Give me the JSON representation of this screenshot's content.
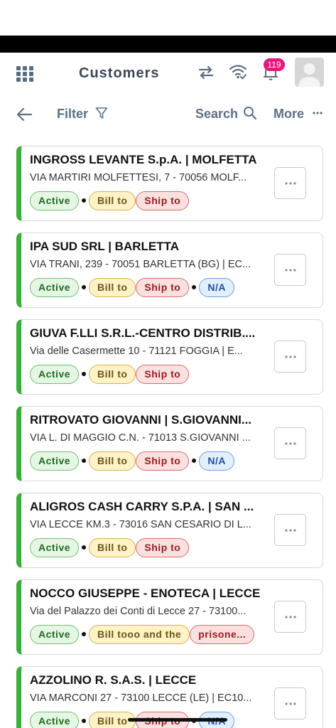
{
  "header": {
    "title": "Customers",
    "notification_count": "119"
  },
  "toolbar": {
    "filter_label": "Filter",
    "search_label": "Search",
    "more_label": "More"
  },
  "colors": {
    "accent_green": "#3aae3a",
    "badge_pink": "#e8157a",
    "header_text": "#3b4656",
    "toolbar_text": "#5c6f87"
  },
  "customers": [
    {
      "name": "INGROSS LEVANTE S.p.A. | MOLFETTA",
      "address": "VIA MARTIRI MOLFETTESI, 7 - 70056 MOLF...",
      "tags": [
        "Active",
        "Bill to",
        "Ship to"
      ]
    },
    {
      "name": "IPA SUD SRL | BARLETTA",
      "address": "VIA TRANI, 239 - 70051 BARLETTA (BG) | EC...",
      "tags": [
        "Active",
        "Bill to",
        "Ship to",
        "N/A"
      ]
    },
    {
      "name": "GIUVA F.LLI S.R.L.-CENTRO DISTRIB....",
      "address": "Via delle Casermette 10 - 71121 FOGGIA | E...",
      "tags": [
        "Active",
        "Bill to",
        "Ship to"
      ]
    },
    {
      "name": "RITROVATO GIOVANNI | S.GIOVANNI...",
      "address": "VIA L. DI MAGGIO C.N. - 71013 S.GIOVANNI ...",
      "tags": [
        "Active",
        "Bill to",
        "Ship to",
        "N/A"
      ]
    },
    {
      "name": "ALIGROS CASH CARRY S.P.A. | SAN ...",
      "address": "VIA LECCE KM.3 - 73016 SAN CESARIO DI L...",
      "tags": [
        "Active",
        "Bill to",
        "Ship to"
      ]
    },
    {
      "name": "NOCCO GIUSEPPE - ENOTECA | LECCE",
      "address": "Via del Palazzo dei Conti di Lecce 27 - 73100...",
      "tags": [
        "Active",
        "Bill tooo and the",
        "prisone..."
      ]
    },
    {
      "name": "AZZOLINO R. S.A.S. | LECCE",
      "address": "VIA MARCONI 27 - 73100 LECCE (LE) | EC10...",
      "tags": [
        "Active",
        "Bill to",
        "Ship to",
        "N/A"
      ]
    }
  ]
}
